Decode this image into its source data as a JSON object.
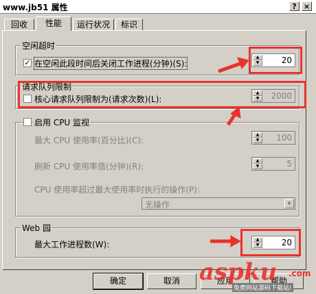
{
  "window": {
    "title": "www.jb51 属性",
    "help_button": "?",
    "close_button": "×"
  },
  "tabs": [
    {
      "label": "回收",
      "active": false
    },
    {
      "label": "性能",
      "active": true
    },
    {
      "label": "运行状况",
      "active": false
    },
    {
      "label": "标识",
      "active": false
    }
  ],
  "idle_timeout": {
    "group_title": "空闲超时",
    "checkbox_label": "在空闲此段时间后关闭工作进程(分钟)(S):",
    "checked": true,
    "value": "20"
  },
  "request_queue": {
    "group_title": "请求队列限制",
    "checkbox_label": "核心请求队列限制为(请求次数)(L):",
    "checked": false,
    "value": "2000"
  },
  "cpu": {
    "group_title": "启用 CPU 监视",
    "checked": false,
    "max_usage_label": "最大 CPU 使用率(百分比)(C):",
    "max_usage_value": "100",
    "refresh_label": "刷新 CPU 使用率值(分钟)(R):",
    "refresh_value": "5",
    "action_label": "CPU 使用率超过最大使用率时执行的操作(P):",
    "action_value": "无操作"
  },
  "web_garden": {
    "group_title": "Web 园",
    "max_processes_label": "最大工作进程数(W):",
    "max_processes_value": "20"
  },
  "buttons": {
    "ok": "确定",
    "cancel": "取消",
    "apply": "应用",
    "help": "帮助"
  },
  "watermark": {
    "logo": "aspku",
    "domain": ".com",
    "tagline": "免费网站源码下载站!"
  },
  "colors": {
    "highlight": "#e8322b",
    "dialog": "#d4d0c8"
  }
}
